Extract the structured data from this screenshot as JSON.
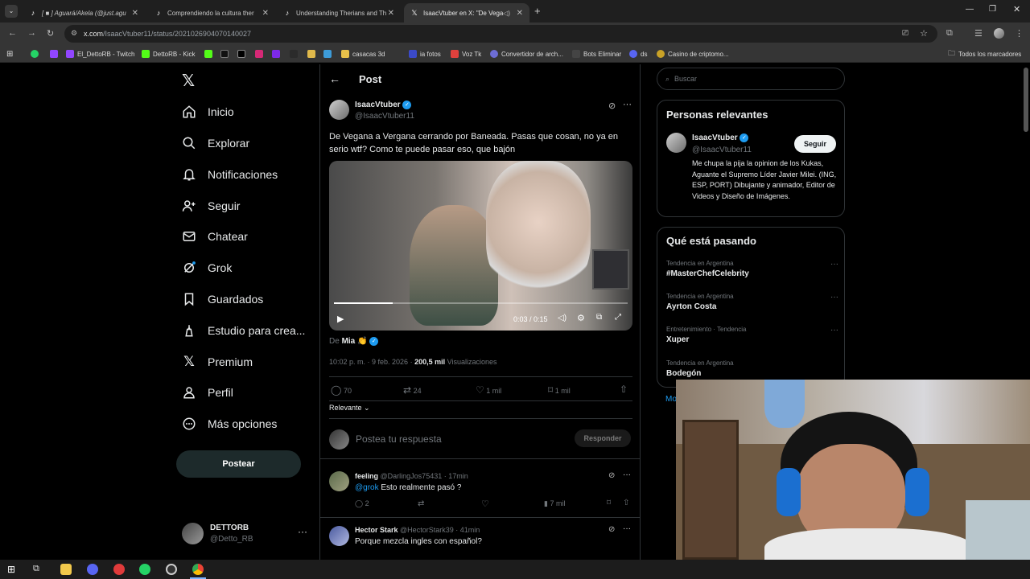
{
  "browser": {
    "tabs": [
      {
        "title": "[ ■ ] Aguará/Akela (@just.agu",
        "favicon": "tiktok"
      },
      {
        "title": "Comprendiendo la cultura ther",
        "favicon": "tiktok"
      },
      {
        "title": "Understanding Therians and Th",
        "favicon": "tiktok"
      },
      {
        "title": "IsaacVtuber en X: \"De Vega",
        "favicon": "x"
      }
    ],
    "url_domain": "x.com",
    "url_path": "/IsaacVtuber11/status/2021026904070140027",
    "bookmarks": [
      "El_DettoRB - Twitch",
      "DettoRB - Kick",
      "casacas 3d",
      "ia fotos",
      "Voz Tk",
      "Convertidor de arch...",
      "Bots Eliminar",
      "ds",
      "Casino de criptomo..."
    ],
    "all_bookmarks": "Todos los marcadores"
  },
  "sidebar": {
    "items": [
      {
        "label": "Inicio",
        "icon": "home-icon"
      },
      {
        "label": "Explorar",
        "icon": "search-icon"
      },
      {
        "label": "Notificaciones",
        "icon": "bell-icon"
      },
      {
        "label": "Seguir",
        "icon": "follow-icon"
      },
      {
        "label": "Chatear",
        "icon": "mail-icon"
      },
      {
        "label": "Grok",
        "icon": "grok-icon"
      },
      {
        "label": "Guardados",
        "icon": "bookmark-icon"
      },
      {
        "label": "Estudio para crea...",
        "icon": "studio-icon"
      },
      {
        "label": "Premium",
        "icon": "x-icon"
      },
      {
        "label": "Perfil",
        "icon": "profile-icon"
      },
      {
        "label": "Más opciones",
        "icon": "more-icon"
      }
    ],
    "post_button": "Postear",
    "account": {
      "name": "DETTORB",
      "handle": "@Detto_RB"
    }
  },
  "post": {
    "header": "Post",
    "author": {
      "name": "IsaacVtuber",
      "handle": "@IsaacVtuber11"
    },
    "text": "De Vegana a Vergana cerrando por Baneada. Pasas que cosan, no ya en serio wtf? Como te puede pasar eso, que bajón",
    "video": {
      "time": "0:03 / 0:15",
      "progress": 0.2
    },
    "source_prefix": "De",
    "source_name": "Mia",
    "timestamp": "10:02 p. m. · 9 feb. 2026 ·",
    "views_value": "200,5 mil",
    "views_label": "Visualizaciones",
    "stats": {
      "replies": "70",
      "reposts": "24",
      "likes": "1 mil",
      "bookmarks": "1 mil"
    },
    "sort": "Relevante",
    "reply_placeholder": "Postea tu respuesta",
    "reply_button": "Responder"
  },
  "replies": [
    {
      "name": "feeling",
      "handle": "@DarlingJos75431",
      "time": "· 17min",
      "mention": "@grok",
      "text": "Esto realmente pasó ?",
      "replies": "2",
      "views": "7 mil"
    },
    {
      "name": "Hector Stark",
      "handle": "@HectorStark39",
      "time": "· 41min",
      "mention": "",
      "text": "Porque mezcla ingles con español?"
    }
  ],
  "right": {
    "search_placeholder": "Buscar",
    "relevant_title": "Personas relevantes",
    "relevant": {
      "name": "IsaacVtuber",
      "handle": "@IsaacVtuber11",
      "follow": "Seguir",
      "bio": "Me chupa la pija la opinion de los Kukas, Aguante el Supremo Líder Javier Milei. (ING, ESP, PORT) Dibujante y animador, Editor de Videos y Diseño de Imágenes."
    },
    "trends_title": "Qué está pasando",
    "trends": [
      {
        "context": "Tendencia en Argentina",
        "topic": "#MasterChefCelebrity"
      },
      {
        "context": "Tendencia en Argentina",
        "topic": "Ayrton Costa"
      },
      {
        "context": "Entretenimiento · Tendencia",
        "topic": "Xuper"
      },
      {
        "context": "Tendencia en Argentina",
        "topic": "Bodegón"
      }
    ],
    "show_more": "Mo"
  },
  "colors": {
    "accent": "#1d9bf0",
    "muted": "#71767b",
    "border": "#2f3336"
  }
}
